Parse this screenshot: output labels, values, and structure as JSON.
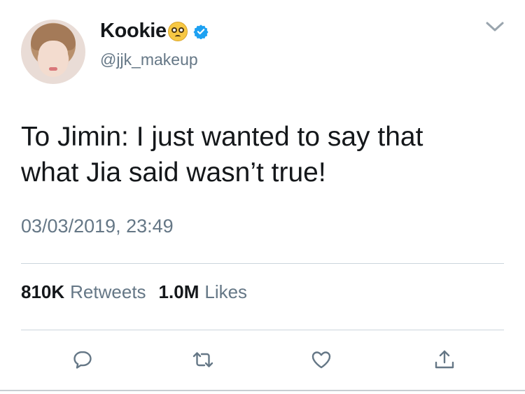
{
  "author": {
    "display_name": "Kookie",
    "handle": "@jjk_makeup",
    "verified": true
  },
  "tweet": {
    "text_line1": "To Jimin: I just wanted to say that",
    "text_line2": "what Jia said wasn’t true!",
    "timestamp": "03/03/2019, 23:49"
  },
  "stats": {
    "retweets_count": "810K",
    "retweets_label": "Retweets",
    "likes_count": "1.0M",
    "likes_label": "Likes"
  },
  "actions": {
    "reply_icon": "reply-icon",
    "retweet_icon": "retweet-icon",
    "like_icon": "heart-icon",
    "share_icon": "share-icon"
  },
  "colors": {
    "text_primary": "#14171a",
    "text_secondary": "#657786",
    "verified_blue": "#1da1f2",
    "divider": "#ccd6dd"
  }
}
